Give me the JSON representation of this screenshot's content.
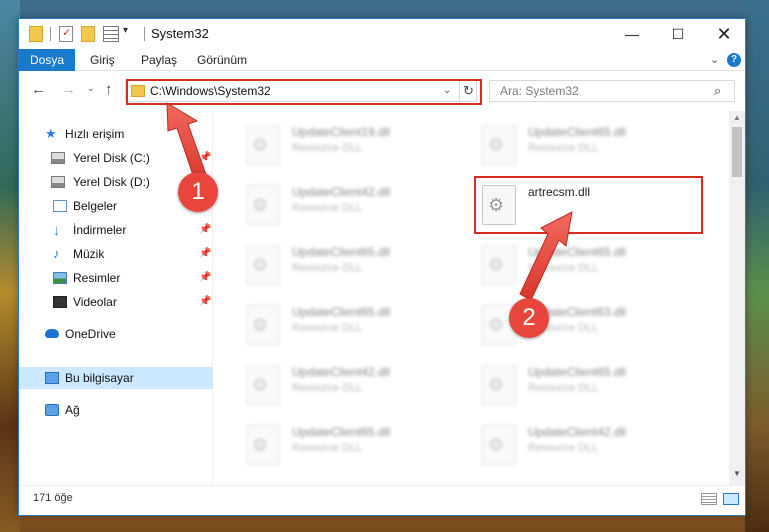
{
  "window": {
    "title": "System32",
    "controls": {
      "minimize": "—",
      "maximize": "☐",
      "close": "✕"
    }
  },
  "ribbon": {
    "tabs": [
      "Dosya",
      "Giriş",
      "Paylaş",
      "Görünüm"
    ],
    "active_tab": "Dosya",
    "chevron": "⌄",
    "help": "?"
  },
  "navigation": {
    "back": "←",
    "forward": "→",
    "recent": "⌄",
    "up": "↑",
    "address": "C:\\Windows\\System32",
    "address_dropdown": "⌄",
    "refresh": "↻",
    "search_placeholder": "Ara: System32",
    "search_icon": "⌕"
  },
  "sidebar": {
    "items": [
      {
        "label": "Hızlı erişim",
        "icon": "star-icon",
        "pinned": false,
        "selected": false
      },
      {
        "label": "Yerel Disk (C:)",
        "icon": "drive-icon",
        "pinned": true,
        "selected": false
      },
      {
        "label": "Yerel Disk (D:)",
        "icon": "drive-icon",
        "pinned": true,
        "selected": false
      },
      {
        "label": "Belgeler",
        "icon": "documents-icon",
        "pinned": true,
        "selected": false
      },
      {
        "label": "İndirmeler",
        "icon": "download-icon",
        "pinned": true,
        "selected": false
      },
      {
        "label": "Müzik",
        "icon": "music-icon",
        "pinned": true,
        "selected": false
      },
      {
        "label": "Resimler",
        "icon": "pictures-icon",
        "pinned": true,
        "selected": false
      },
      {
        "label": "Videolar",
        "icon": "videos-icon",
        "pinned": true,
        "selected": false
      },
      {
        "label": "OneDrive",
        "icon": "cloud-icon",
        "pinned": false,
        "selected": false
      },
      {
        "label": "Bu bilgisayar",
        "icon": "computer-icon",
        "pinned": false,
        "selected": true
      },
      {
        "label": "Ağ",
        "icon": "network-icon",
        "pinned": false,
        "selected": false
      }
    ],
    "pin_glyph": "📌"
  },
  "files": [
    {
      "name": "UpdateClient19.dll",
      "type": "Resource DLL",
      "blurred": true
    },
    {
      "name": "UpdateClient65.dll",
      "type": "Resource DLL",
      "blurred": true
    },
    {
      "name": "UpdateClient42.dll",
      "type": "Resource DLL",
      "blurred": true
    },
    {
      "name": "artrecsm.dll",
      "type": "",
      "blurred": false,
      "highlighted": true
    },
    {
      "name": "UpdateClient65.dll",
      "type": "Resource DLL",
      "blurred": true
    },
    {
      "name": "UpdateClient65.dll",
      "type": "Resource DLL",
      "blurred": true
    },
    {
      "name": "UpdateClient65.dll",
      "type": "Resource DLL",
      "blurred": true
    },
    {
      "name": "UpdateClient63.dll",
      "type": "Resource DLL",
      "blurred": true
    },
    {
      "name": "UpdateClient42.dll",
      "type": "Resource DLL",
      "blurred": true
    },
    {
      "name": "UpdateClient65.dll",
      "type": "Resource DLL",
      "blurred": true
    },
    {
      "name": "UpdateClient65.dll",
      "type": "Resource DLL",
      "blurred": true
    },
    {
      "name": "UpdateClient42.dll",
      "type": "Resource DLL",
      "blurred": true
    }
  ],
  "status": {
    "item_count": "171 öğe"
  },
  "annotations": {
    "step1": "1",
    "step2": "2",
    "highlight_color": "#d62d20",
    "badge_color": "#e8453c"
  },
  "colors": {
    "accent": "#1979ca",
    "selection": "#cce8ff"
  }
}
